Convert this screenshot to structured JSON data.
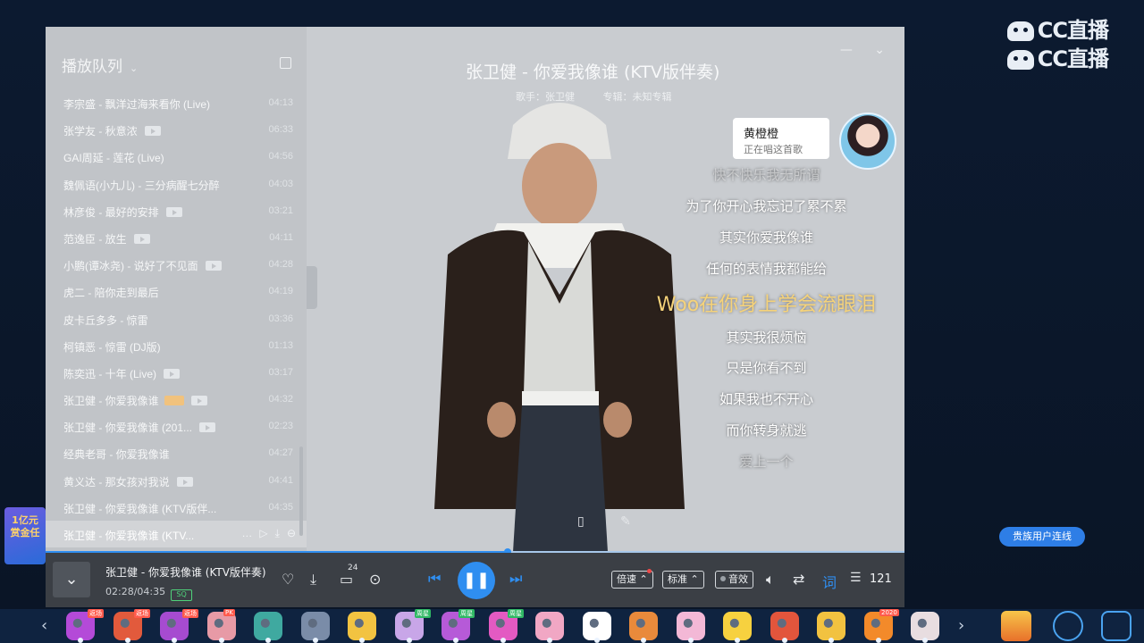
{
  "watermark": {
    "line1": "CC直播",
    "line2": "CC直播"
  },
  "playlist": {
    "title": "播放队列",
    "items": [
      {
        "name": "李宗盛 - 飘洋过海来看你 (Live)",
        "duration": "04:13",
        "mv": false,
        "tag": false
      },
      {
        "name": "张学友 - 秋意浓",
        "duration": "06:33",
        "mv": true,
        "tag": false
      },
      {
        "name": "GAI周延 - 莲花 (Live)",
        "duration": "04:56",
        "mv": false,
        "tag": false
      },
      {
        "name": "魏佩语(小九儿) - 三分病醒七分醉",
        "duration": "04:03",
        "mv": false,
        "tag": false
      },
      {
        "name": "林彦俊 - 最好的安排",
        "duration": "03:21",
        "mv": true,
        "tag": false
      },
      {
        "name": "范逸臣 - 放生",
        "duration": "04:11",
        "mv": true,
        "tag": false
      },
      {
        "name": "小鹏(谭冰尧) - 说好了不见面",
        "duration": "04:28",
        "mv": true,
        "tag": false
      },
      {
        "name": "虎二 - 陪你走到最后",
        "duration": "04:19",
        "mv": false,
        "tag": false
      },
      {
        "name": "皮卡丘多多 - 惊雷",
        "duration": "03:36",
        "mv": false,
        "tag": false
      },
      {
        "name": "柯镇恶 - 惊雷 (DJ版)",
        "duration": "01:13",
        "mv": false,
        "tag": false
      },
      {
        "name": "陈奕迅 - 十年 (Live)",
        "duration": "03:17",
        "mv": true,
        "tag": false
      },
      {
        "name": "张卫健 - 你爱我像谁",
        "duration": "04:32",
        "mv": true,
        "tag": true
      },
      {
        "name": "张卫健 - 你爱我像谁 (201...",
        "duration": "02:23",
        "mv": true,
        "tag": false
      },
      {
        "name": "经典老哥 - 你爱我像谁",
        "duration": "04:27",
        "mv": false,
        "tag": false
      },
      {
        "name": "黄义达 - 那女孩对我说",
        "duration": "04:41",
        "mv": true,
        "tag": false
      },
      {
        "name": "张卫健 - 你爱我像谁 (KTV版伴...",
        "duration": "04:35",
        "mv": false,
        "tag": false
      }
    ],
    "active_item": "张卫健 - 你爱我像谁 (KTV...",
    "active_actions": [
      "…",
      "▷",
      "⤓",
      "⊖"
    ]
  },
  "now_playing": {
    "title": "张卫健 - 你爱我像谁 (KTV版伴奏)",
    "singer_label": "歌手：张卫健",
    "album_label": "专辑：未知专辑"
  },
  "singer_card": {
    "name": "黄橙橙",
    "status": "正在唱这首歌"
  },
  "lyrics": [
    {
      "text": "快不快乐我无所谓",
      "state": "dim"
    },
    {
      "text": "为了你开心我忘记了累不累",
      "state": "normal"
    },
    {
      "text": "其实你爱我像谁",
      "state": "normal"
    },
    {
      "text": "任何的表情我都能给",
      "state": "normal"
    },
    {
      "text": "Woo在你身上学会流眼泪",
      "state": "current"
    },
    {
      "text": "其实我很烦恼",
      "state": "normal"
    },
    {
      "text": "只是你看不到",
      "state": "normal"
    },
    {
      "text": "如果我也不开心",
      "state": "normal"
    },
    {
      "text": "而你转身就逃",
      "state": "normal"
    },
    {
      "text": "爱上一个",
      "state": "dim"
    }
  ],
  "controls": {
    "song": "张卫健 - 你爱我像谁 (KTV版伴奏)",
    "time": "02:28/04:35",
    "quality": "SQ",
    "comment_count": "24",
    "speed_label": "倍速",
    "standard_label": "标准",
    "effect_label": "音效",
    "playlist_count": "121",
    "progress": 0.5385
  },
  "promo": {
    "line1": "1亿元",
    "line2": "赏金任"
  },
  "link_button": "贵族用户连线",
  "gift_badges": [
    "返场",
    "返场",
    "返场",
    "PK",
    "周星",
    "周星",
    "周星",
    "2020"
  ],
  "colors": {
    "accent": "#2f8ef0",
    "current_lyric": "#f6d37a"
  }
}
